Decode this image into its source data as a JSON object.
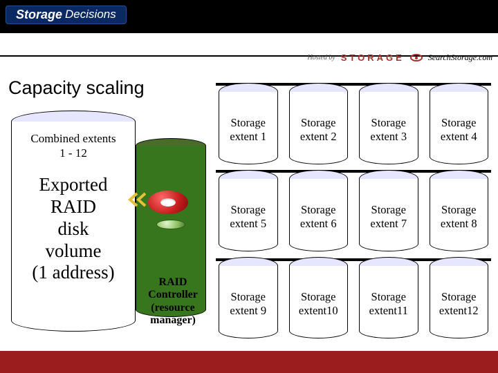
{
  "header": {
    "logo_primary": "Storage",
    "logo_secondary": "Decisions",
    "hosted_by": "Hosted by",
    "vendor": "STORAGE",
    "search_label": "SearchStorage.com"
  },
  "title": "Capacity scaling",
  "combined": {
    "line1": "Combined extents",
    "line2": "1 - 12"
  },
  "exported": {
    "line1": "Exported",
    "line2": "RAID",
    "line3": "disk",
    "line4": "volume",
    "line5": "(1 address)"
  },
  "controller": {
    "line1": "RAID",
    "line2": "Controller",
    "line3": "(resource",
    "line4": "manager)"
  },
  "extents": [
    {
      "l1": "Storage",
      "l2": "extent 1"
    },
    {
      "l1": "Storage",
      "l2": "extent 2"
    },
    {
      "l1": "Storage",
      "l2": "extent 3"
    },
    {
      "l1": "Storage",
      "l2": "extent 4"
    },
    {
      "l1": "Storage",
      "l2": "extent 5"
    },
    {
      "l1": "Storage",
      "l2": "extent 6"
    },
    {
      "l1": "Storage",
      "l2": "extent 7"
    },
    {
      "l1": "Storage",
      "l2": "extent 8"
    },
    {
      "l1": "Storage",
      "l2": "extent 9"
    },
    {
      "l1": "Storage",
      "l2": "extent10"
    },
    {
      "l1": "Storage",
      "l2": "extent11"
    },
    {
      "l1": "Storage",
      "l2": "extent12"
    }
  ],
  "colors": {
    "header_bg": "#000000",
    "logo_bg": "#0a2963",
    "controller_fill": "#38761d",
    "torus": "#c81e1e",
    "lens": "#8cbf60",
    "footer": "#9b1d1d",
    "cylinder_top": "#e6e7ff",
    "vendor_text": "#a62f2a"
  }
}
